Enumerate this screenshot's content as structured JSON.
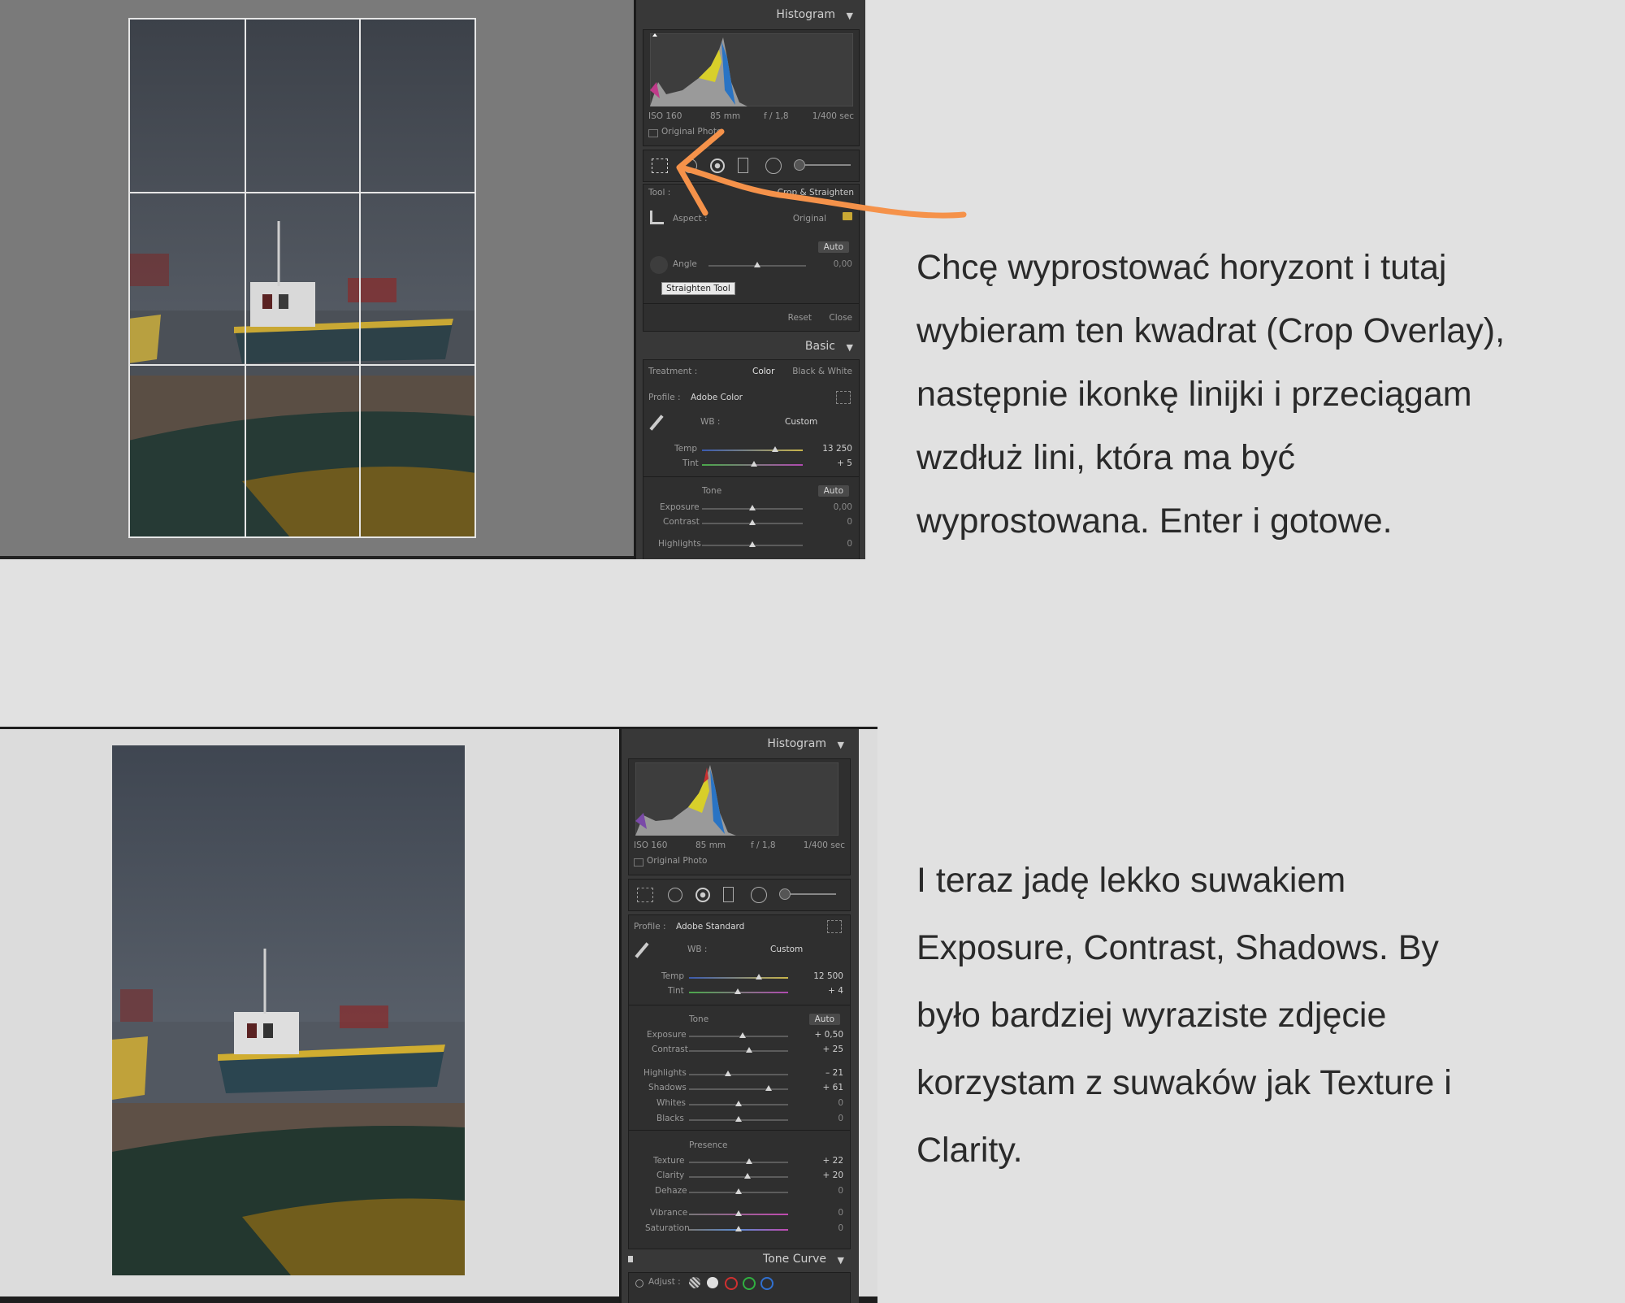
{
  "captions": {
    "top": "Chcę wyprostować horyzont i tutaj\nwybieram ten kwadrat (Crop Overlay),\nnastępnie ikonkę linijki i przeciągam\nwzdłuż lini, która ma być\nwyprostowana. Enter i gotowe.",
    "bottom": "I teraz jadę lekko suwakiem\nExposure, Contrast, Shadows. By\nbyło bardziej wyraziste zdjęcie\nkorzystam z suwaków jak Texture i\nClarity."
  },
  "colors": {
    "arrow": "#f5924a",
    "panel_bg": "#383838",
    "canvas_gray": "#7a7a7a"
  },
  "top": {
    "histogram": {
      "title": "Histogram",
      "iso": "ISO 160",
      "focal": "85 mm",
      "aperture": "f / 1,8",
      "shutter": "1/400 sec",
      "original_photo": "Original Photo"
    },
    "crop": {
      "tool_label": "Tool :",
      "tool_value": "Crop & Straighten",
      "aspect_label": "Aspect :",
      "aspect_value": "Original",
      "auto": "Auto",
      "angle_label": "Angle",
      "angle_value": "0,00",
      "tooltip": "Straighten Tool",
      "reset": "Reset",
      "close": "Close"
    },
    "basic": {
      "title": "Basic",
      "treatment_label": "Treatment :",
      "color": "Color",
      "bw": "Black & White",
      "profile_label": "Profile :",
      "profile_value": "Adobe Color",
      "wb_label": "WB :",
      "wb_value": "Custom",
      "temp_label": "Temp",
      "temp_value": "13 250",
      "tint_label": "Tint",
      "tint_value": "+ 5",
      "tone_label": "Tone",
      "auto": "Auto",
      "exposure_label": "Exposure",
      "exposure_value": "0,00",
      "contrast_label": "Contrast",
      "contrast_value": "0",
      "highlights_label": "Highlights",
      "highlights_value": "0"
    }
  },
  "bottom": {
    "histogram": {
      "title": "Histogram",
      "iso": "ISO 160",
      "focal": "85 mm",
      "aperture": "f / 1,8",
      "shutter": "1/400 sec",
      "original_photo": "Original Photo"
    },
    "basic": {
      "profile_label": "Profile :",
      "profile_value": "Adobe Standard",
      "wb_label": "WB :",
      "wb_value": "Custom",
      "temp_label": "Temp",
      "temp_value": "12 500",
      "tint_label": "Tint",
      "tint_value": "+ 4",
      "tone_label": "Tone",
      "auto": "Auto",
      "exposure_label": "Exposure",
      "exposure_value": "+ 0,50",
      "contrast_label": "Contrast",
      "contrast_value": "+ 25",
      "highlights_label": "Highlights",
      "highlights_value": "– 21",
      "shadows_label": "Shadows",
      "shadows_value": "+ 61",
      "whites_label": "Whites",
      "whites_value": "0",
      "blacks_label": "Blacks",
      "blacks_value": "0",
      "presence_label": "Presence",
      "texture_label": "Texture",
      "texture_value": "+ 22",
      "clarity_label": "Clarity",
      "clarity_value": "+ 20",
      "dehaze_label": "Dehaze",
      "dehaze_value": "0",
      "vibrance_label": "Vibrance",
      "vibrance_value": "0",
      "saturation_label": "Saturation",
      "saturation_value": "0"
    },
    "tone_curve": {
      "title": "Tone Curve",
      "adjust_label": "Adjust :"
    }
  }
}
